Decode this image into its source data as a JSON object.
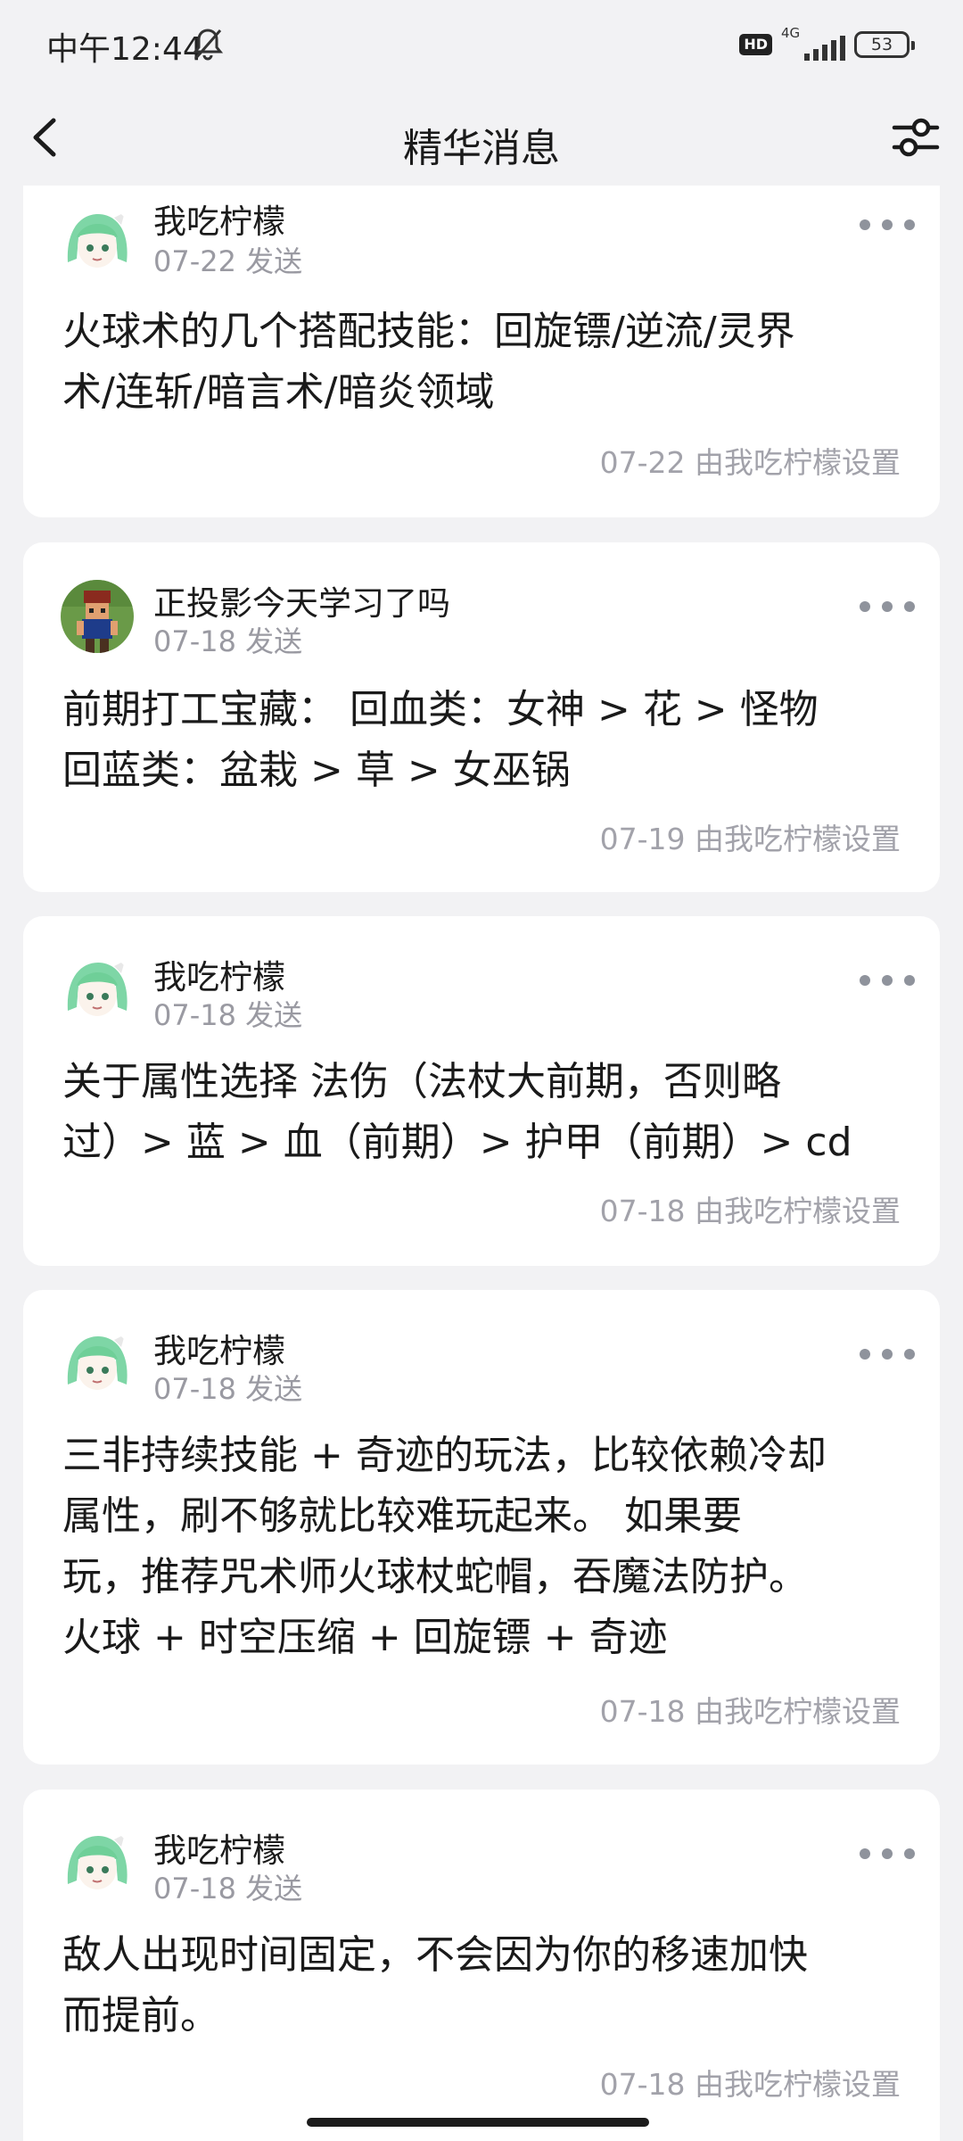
{
  "status_bar": {
    "time": "中午12:44",
    "hd": "HD",
    "network": "4G",
    "battery": "53"
  },
  "header": {
    "title": "精华消息"
  },
  "icons": {
    "back": "back-arrow-icon",
    "filter": "sliders-icon",
    "more": "more-dots-icon",
    "bell": "bell-off-icon"
  },
  "cards": [
    {
      "sender": "我吃柠檬",
      "date": "07-22",
      "sent_label": "发送",
      "content_lines": [
        "火球术的几个搭配技能：回旋镖/逆流/灵界",
        "术/连斩/暗言术/暗炎领域"
      ],
      "setter": "07-22 由我吃柠檬设置",
      "avatar": "anime-girl-green-hair"
    },
    {
      "sender": "正投影今天学习了吗",
      "date": "07-18",
      "sent_label": "发送",
      "content_lines": [
        "前期打工宝藏： 回血类：女神 > 花 > 怪物",
        "回蓝类：盆栽 > 草 > 女巫锅"
      ],
      "setter": "07-19 由我吃柠檬设置",
      "avatar": "pixel-character"
    },
    {
      "sender": "我吃柠檬",
      "date": "07-18",
      "sent_label": "发送",
      "content_lines": [
        "关于属性选择 法伤（法杖大前期，否则略",
        "过）> 蓝 > 血（前期）> 护甲（前期）> cd"
      ],
      "setter": "07-18 由我吃柠檬设置",
      "avatar": "anime-girl-green-hair"
    },
    {
      "sender": "我吃柠檬",
      "date": "07-18",
      "sent_label": "发送",
      "content_lines": [
        "三非持续技能 + 奇迹的玩法，比较依赖冷却",
        "属性，刷不够就比较难玩起来。 如果要",
        "玩，推荐咒术师火球杖蛇帽，吞魔法防护。",
        "火球 + 时空压缩 + 回旋镖 + 奇迹"
      ],
      "setter": "07-18 由我吃柠檬设置",
      "avatar": "anime-girl-green-hair"
    },
    {
      "sender": "我吃柠檬",
      "date": "07-18",
      "sent_label": "发送",
      "content_lines": [
        "敌人出现时间固定，不会因为你的移速加快",
        "而提前。"
      ],
      "setter": "07-18 由我吃柠檬设置",
      "avatar": "anime-girl-green-hair"
    }
  ]
}
